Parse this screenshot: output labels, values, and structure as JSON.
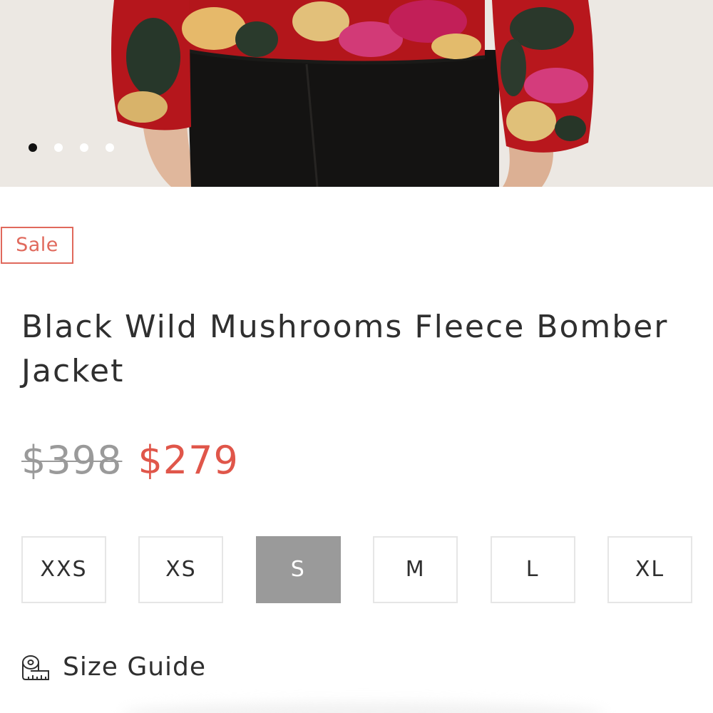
{
  "gallery": {
    "slide_count": 4,
    "active_index": 0
  },
  "badge": {
    "label": "Sale",
    "color": "#e0695c"
  },
  "product": {
    "title": "Black Wild Mushrooms Fleece Bomber Jacket"
  },
  "price": {
    "original": "$398",
    "sale": "$279",
    "sale_color": "#e0564a"
  },
  "sizes": {
    "options": [
      "XXS",
      "XS",
      "S",
      "M",
      "L",
      "XL"
    ],
    "selected": "S"
  },
  "size_guide": {
    "label": "Size Guide",
    "icon": "measuring-tape-icon"
  }
}
